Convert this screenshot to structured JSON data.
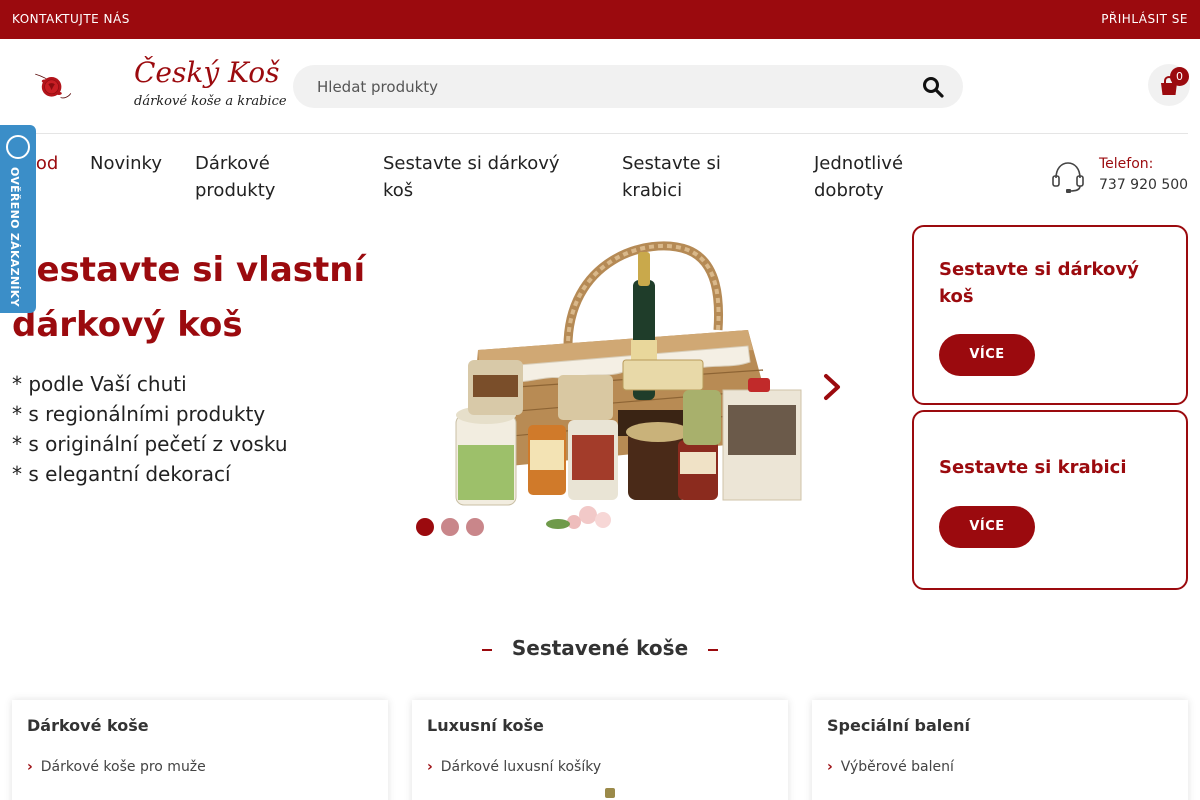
{
  "topbar": {
    "contact_label": "KONTAKTUJTE NÁS",
    "login_label": "PŘIHLÁSIT SE"
  },
  "header": {
    "logo": {
      "title": "Český Koš",
      "subtitle": "dárkové koše a krabice"
    },
    "search": {
      "placeholder": "Hledat produkty",
      "icon": "search-icon"
    },
    "cart": {
      "count": "0",
      "icon": "shopping-bag-icon"
    }
  },
  "nav": {
    "items": [
      {
        "label": "Úvod",
        "active": true
      },
      {
        "label": "Novinky"
      },
      {
        "label": "Dárkové produkty"
      },
      {
        "label": "Sestavte si dárkový koš"
      },
      {
        "label": "Sestavte si krabici"
      },
      {
        "label": "Jednotlivé dobroty"
      }
    ],
    "phone": {
      "icon": "headset-icon",
      "label": "Telefon:",
      "number": "737 920 500"
    }
  },
  "verified_badge": {
    "text": "OVĚŘENO ZÁKAZNÍKY"
  },
  "hero": {
    "title": "Sestavte si vlastní dárkový koš",
    "bullets": [
      "* podle Vaší chuti",
      "* s regionálními produkty",
      "* s originální pečetí z vosku",
      "* s elegantní dekorací"
    ],
    "slider": {
      "next_icon": "chevron-right-icon",
      "slides": 3,
      "active_slide": 1
    }
  },
  "promos": [
    {
      "title": "Sestavte si dárkový koš",
      "button": "VÍCE"
    },
    {
      "title": "Sestavte si krabici",
      "button": "VÍCE"
    }
  ],
  "section": {
    "heading": "Sestavené koše"
  },
  "categories": [
    {
      "title": "Dárkové koše",
      "link": "Dárkové koše pro muže"
    },
    {
      "title": "Luxusní koše",
      "link": "Dárkové luxusní košíky"
    },
    {
      "title": "Speciální balení",
      "link": "Výběrové balení"
    }
  ],
  "colors": {
    "brand": "#9b0a0e",
    "verified_blue": "#3b8ec8",
    "dot_inactive": "#c9868a"
  }
}
